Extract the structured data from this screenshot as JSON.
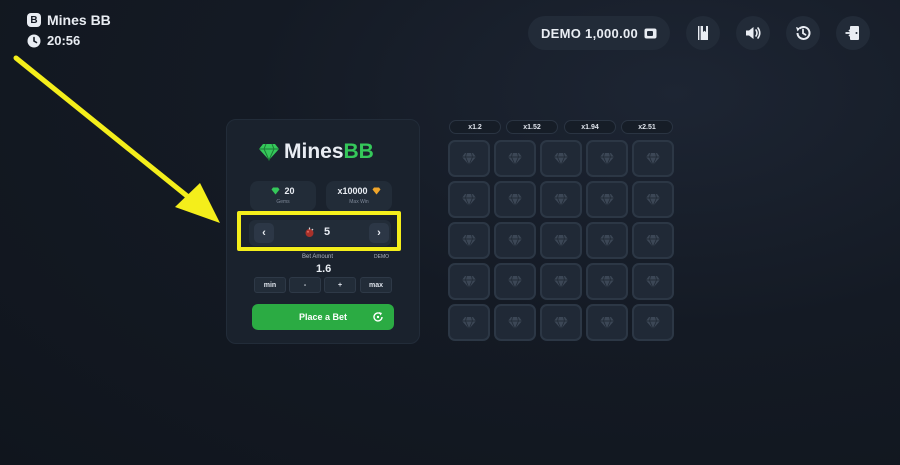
{
  "header": {
    "logo_letter": "B",
    "game_name": "Mines BB",
    "time": "20:56",
    "balance": "DEMO 1,000.00"
  },
  "icons": {
    "rules": "book-icon",
    "sound": "speaker-icon",
    "history": "history-icon",
    "exit": "exit-icon"
  },
  "panel": {
    "logo_main": "Mines",
    "logo_accent": "BB",
    "gems": {
      "value": "20",
      "label": "Gems"
    },
    "max_win": {
      "value": "x10000",
      "label": "Max Win"
    },
    "mines": {
      "prev": "‹",
      "next": "›",
      "value": "5"
    },
    "bet": {
      "label": "Bet Amount",
      "currency": "DEMO",
      "value": "1.6"
    },
    "buttons": {
      "min": "min",
      "minus": "-",
      "plus": "+",
      "max": "max"
    },
    "place_bet": "Place a Bet"
  },
  "multipliers": [
    "x1.2",
    "x1.52",
    "x1.94",
    "x2.51"
  ],
  "grid": {
    "rows": 5,
    "cols": 5
  },
  "colors": {
    "accent_green": "#35c85a",
    "button_green": "#2bab43",
    "annotation_yellow": "#f4ee1b"
  }
}
